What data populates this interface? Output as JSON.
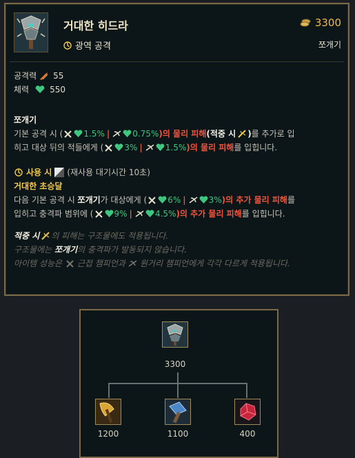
{
  "item": {
    "name": "거대한 히드라",
    "tag": "광역 공격",
    "cost": "3300",
    "type": "쪼개기"
  },
  "stats": [
    {
      "label": "공격력",
      "icon": "attack-damage-icon",
      "value": "55"
    },
    {
      "label": "체력",
      "icon": "health-heart-icon",
      "value": "550"
    }
  ],
  "passive": {
    "title": "쪼개기",
    "line1": {
      "pre": "기본 공격 시 (",
      "melee_value": "1.5%",
      "ranged_value": "0.75%",
      "post_red": ")의 물리 피해",
      "on_hit_open": "(",
      "on_hit_label": "적중 시",
      "on_hit_close": ")",
      "suffix": "를 추가로 입"
    },
    "line2": {
      "pre": "히고 대상 뒤의 적들에게 (",
      "melee_value": "3%",
      "ranged_value": "1.5%",
      "post_red": ")의 물리 피해",
      "suffix": "를 입힙니다."
    }
  },
  "active": {
    "label": "사용 시",
    "cooldown_text": "(재사용 대기시간 10초)",
    "name": "거대한 초승달",
    "line1": {
      "pre": "다음 기본 공격 시 ",
      "bold": "쪼개기",
      "mid": "가 대상에게 (",
      "melee_value": "6%",
      "ranged_value": "3%",
      "post_red": ")의 추가 물리 피해",
      "suffix": "를"
    },
    "line2": {
      "pre": "입히고 충격파 범위에 (",
      "melee_value": "9%",
      "ranged_value": "4.5%",
      "post_red": ")의 추가 물리 피해",
      "suffix": "를 입힙니다."
    }
  },
  "notes": {
    "n1_bold": "적중 시",
    "n1_rest": "의 피해는 구조물에도 적용됩니다.",
    "n2_pre": "구조물에는 ",
    "n2_bold": "쪼개기",
    "n2_rest": "의 충격파가 발동되지 않습니다.",
    "n3_pre": "아이템 성능은 ",
    "n3_melee": "근접 챔피언과",
    "n3_ranged": "원거리 챔피언에게 각각 다르게 적용됩니다."
  },
  "recipe": {
    "root": {
      "name": "거대한 히드라",
      "icon": "ravenous-hydra-icon",
      "price": "3300"
    },
    "components": [
      {
        "icon": "golden-axe-icon",
        "price": "1200"
      },
      {
        "icon": "blue-hammer-icon",
        "price": "1100"
      },
      {
        "icon": "ruby-crystal-icon",
        "price": "400"
      }
    ]
  },
  "colors": {
    "gold": "#f2c94c",
    "damage_red": "#f0543d",
    "heal_green": "#3fc77f",
    "frame_border": "#7a6a48",
    "background": "#0c1518"
  }
}
